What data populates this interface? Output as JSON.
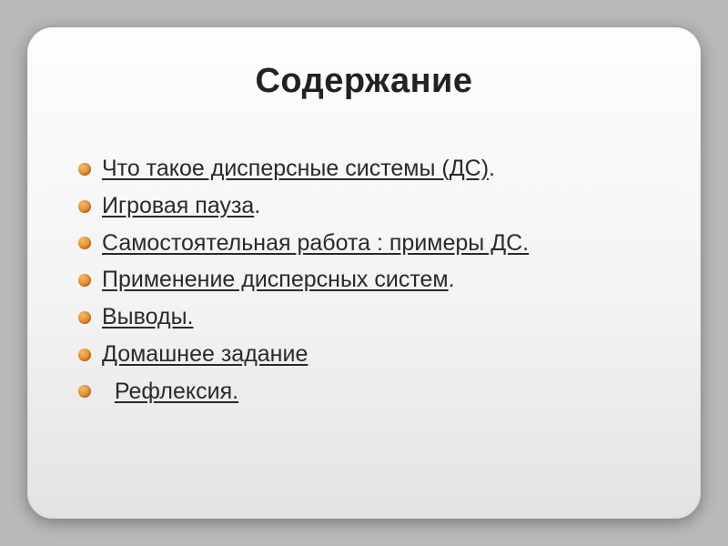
{
  "title": "Содержание",
  "items": [
    {
      "underlined": "Что такое дисперсные системы (ДС)",
      "after": "."
    },
    {
      "underlined": "Игровая пауза",
      "after": "."
    },
    {
      "underlined": "Самостоятельная работа : примеры ДС.",
      "after": ""
    },
    {
      "underlined": "Применение дисперсных систем",
      "after": "."
    },
    {
      "underlined": "Выводы.",
      "after": ""
    },
    {
      "underlined": "Домашнее задание",
      "after": ""
    },
    {
      "before": "  ",
      "underlined": "Рефлексия.",
      "after": ""
    }
  ]
}
